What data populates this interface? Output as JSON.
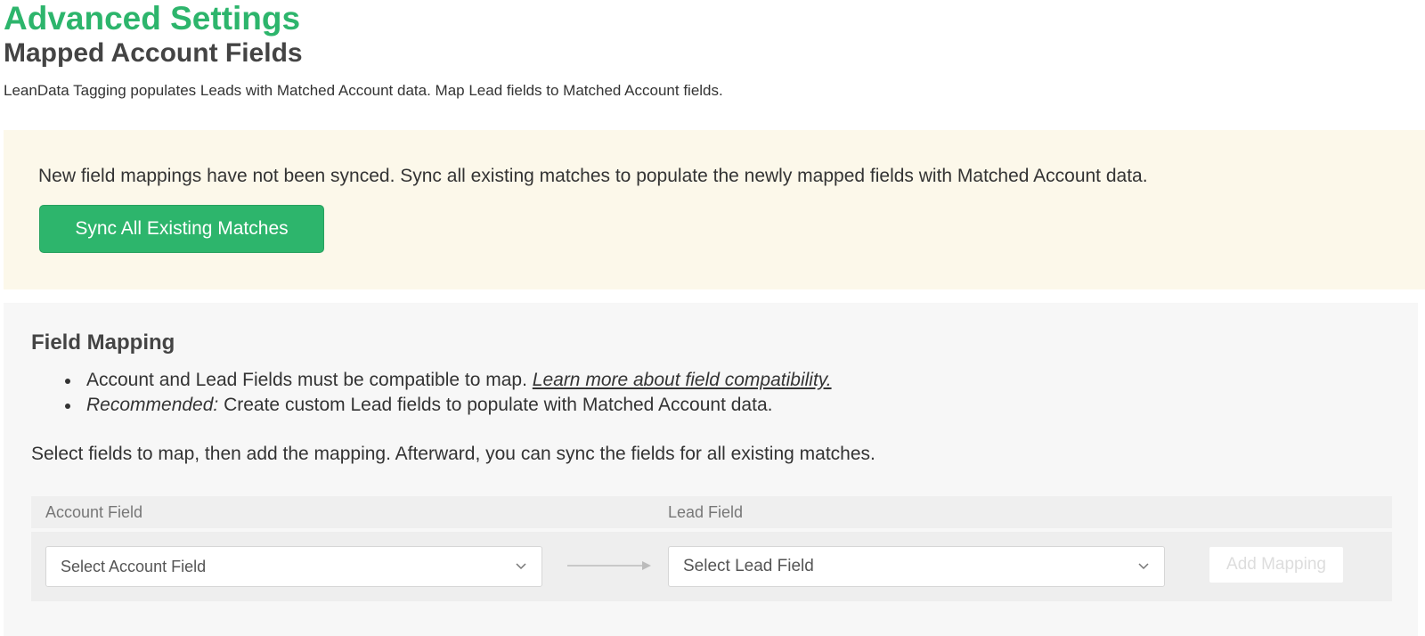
{
  "header": {
    "title": "Advanced Settings",
    "subtitle": "Mapped Account Fields",
    "description": "LeanData Tagging populates Leads with Matched Account data. Map Lead fields to Matched Account fields."
  },
  "notice": {
    "message": "New field mappings have not been synced. Sync all existing matches to populate the newly mapped fields with Matched Account data.",
    "sync_button_label": "Sync All Existing Matches"
  },
  "field_mapping": {
    "title": "Field Mapping",
    "bullet1_text": "Account and Lead Fields must be compatible to map. ",
    "bullet1_link": "Learn more about field compatibility.",
    "bullet2_em": "Recommended:",
    "bullet2_text": " Create custom Lead fields to populate with Matched Account data.",
    "instructions": "Select fields to map, then add the mapping. Afterward, you can sync the fields for all existing matches.",
    "columns": {
      "account": "Account Field",
      "lead": "Lead Field"
    },
    "account_select_placeholder": "Select Account Field",
    "lead_select_placeholder": "Select Lead Field",
    "add_button_label": "Add Mapping"
  },
  "colors": {
    "brand_green": "#2db56c",
    "notice_bg": "#fcf8ea",
    "panel_bg": "#f7f7f7"
  },
  "icons": {
    "select_chevron": "chevron-down-icon",
    "mapping_arrow": "arrow-right-icon"
  }
}
